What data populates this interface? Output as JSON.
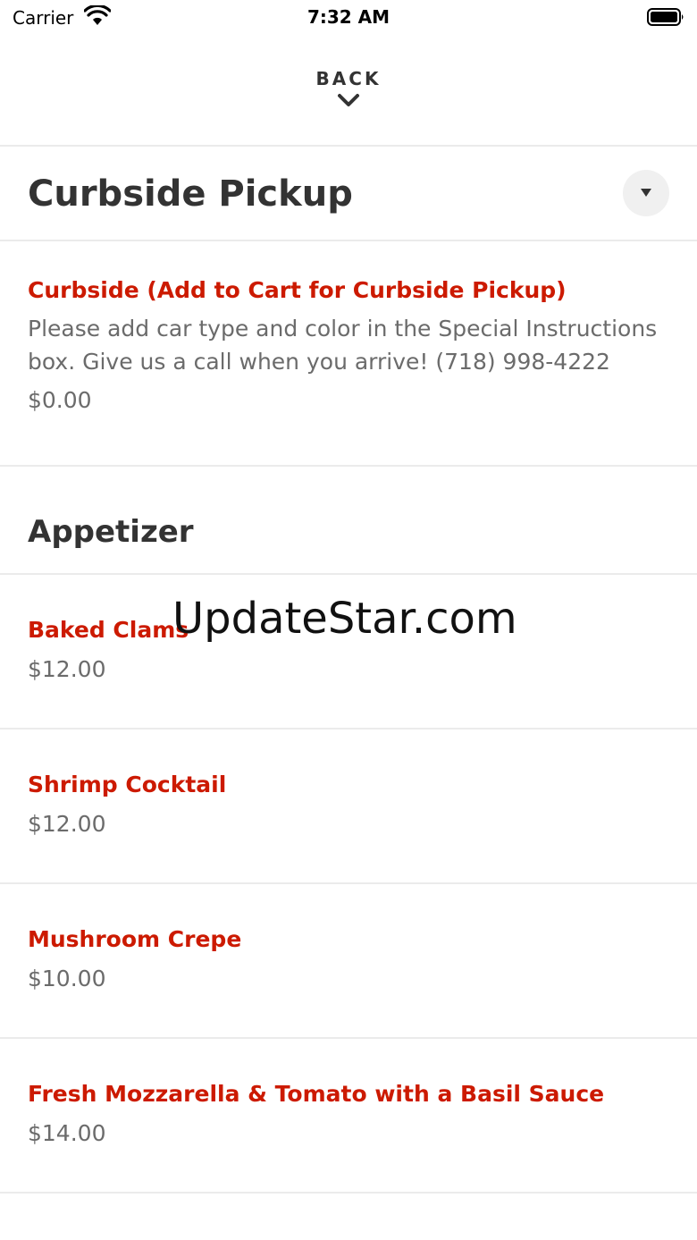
{
  "status_bar": {
    "carrier": "Carrier",
    "time": "7:32 AM"
  },
  "nav": {
    "back_label": "BACK"
  },
  "section_curbside": {
    "title": "Curbside Pickup",
    "item": {
      "name": "Curbside (Add to Cart for Curbside Pickup)",
      "description": "Please add car type and color in the Special Instructions box. Give us a call when you arrive! (718) 998-4222",
      "price": "$0.00"
    }
  },
  "section_appetizer": {
    "title": "Appetizer",
    "items": [
      {
        "name": "Baked Clams",
        "price": "$12.00"
      },
      {
        "name": "Shrimp Cocktail",
        "price": "$12.00"
      },
      {
        "name": "Mushroom Crepe",
        "price": "$10.00"
      },
      {
        "name": "Fresh Mozzarella & Tomato with a Basil Sauce",
        "price": "$14.00"
      }
    ]
  },
  "watermark": "UpdateStar.com",
  "colors": {
    "accent": "#cc1a00",
    "text": "#333333",
    "muted": "#6b6b6b",
    "divider": "#ebebeb"
  }
}
